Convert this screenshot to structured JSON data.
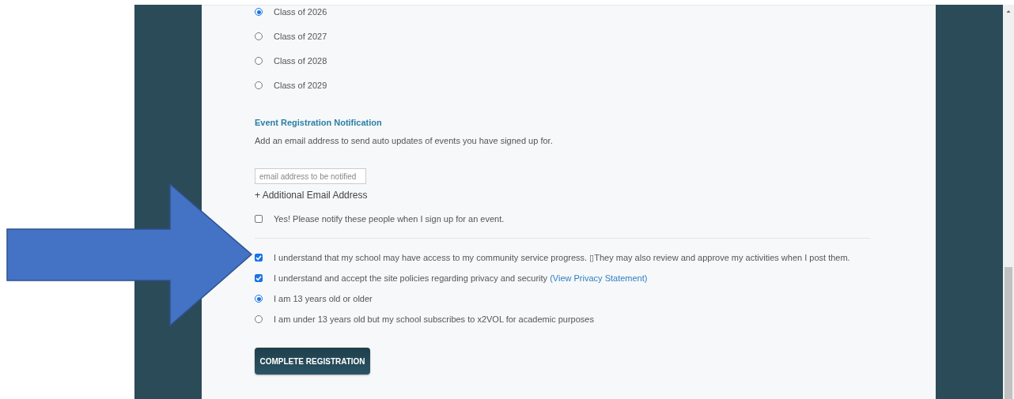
{
  "class_year": {
    "options": [
      {
        "label": "Class of 2026",
        "selected": true
      },
      {
        "label": "Class of 2027",
        "selected": false
      },
      {
        "label": "Class of 2028",
        "selected": false
      },
      {
        "label": "Class of 2029",
        "selected": false
      }
    ]
  },
  "notification": {
    "heading": "Event Registration Notification",
    "description": "Add an email address to send auto updates of events you have signed up for.",
    "email_field": {
      "placeholder": "email address to be notified"
    },
    "add_link": "+ Additional Email Address",
    "notify_checkbox": {
      "label": "Yes! Please notify these people when I sign up for an event.",
      "checked": false
    }
  },
  "agreements": [
    {
      "kind": "checkbox",
      "label": "I understand that my school may have access to my community service progress. ▯They may also review and approve my activities when I post them.",
      "checked": true
    },
    {
      "kind": "checkbox",
      "label": "I understand and accept the site policies regarding privacy and security ",
      "link": "(View Privacy Statement)",
      "checked": true
    },
    {
      "kind": "radio",
      "label": "I am 13 years old or older",
      "selected": true
    },
    {
      "kind": "radio",
      "label": "I am under 13 years old but my school subscribes to x2VOL for academic purposes",
      "selected": false
    }
  ],
  "submit_button": "COMPLETE REGISTRATION"
}
